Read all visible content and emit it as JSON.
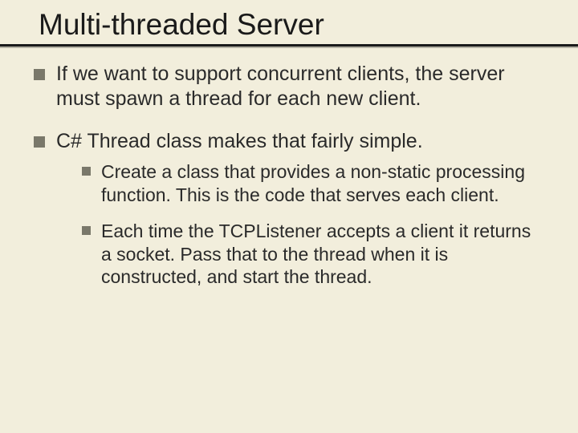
{
  "title": "Multi-threaded Server",
  "bullets": {
    "b1": "If we want to support concurrent clients, the server must spawn a thread for each new client.",
    "b2": "C# Thread class makes that fairly simple.",
    "b2_1": "Create a class that provides a non-static processing function.  This is the code that serves each client.",
    "b2_2": "Each time the TCPListener accepts a client it returns a socket.  Pass that to the thread when it is constructed, and start the thread."
  }
}
